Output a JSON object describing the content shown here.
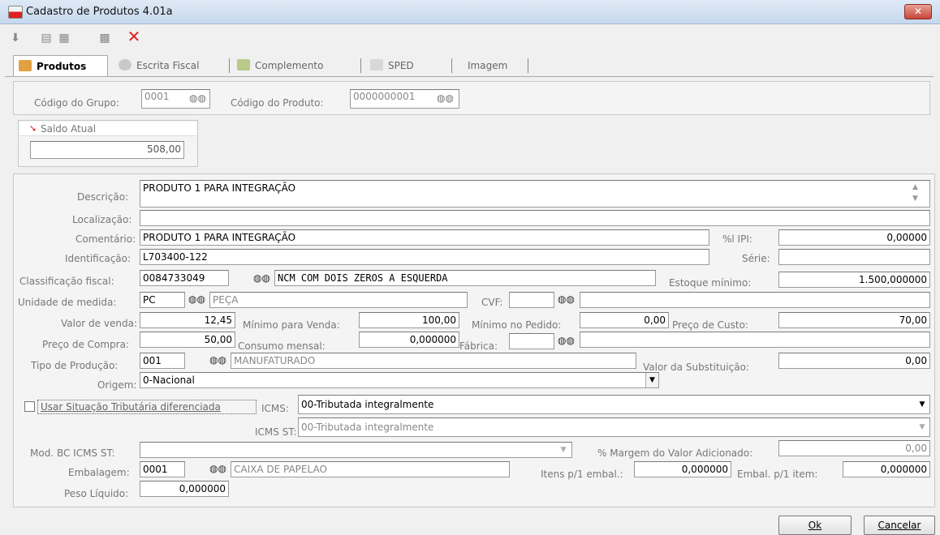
{
  "window": {
    "title": "Cadastro de Produtos 4.01a",
    "close": "✕"
  },
  "toolbar": {
    "delete_label": "✕"
  },
  "tabs": [
    "Produtos",
    "Escrita Fiscal",
    "Complemento",
    "SPED",
    "Imagem"
  ],
  "header": {
    "grupo_label": "Código do Grupo:",
    "grupo_value": "0001",
    "produto_label": "Código do Produto:",
    "produto_value": "0000000001"
  },
  "saldo": {
    "label": "Saldo Atual",
    "value": "508,00"
  },
  "form": {
    "descricao_label": "Descrição:",
    "descricao": "PRODUTO 1 PARA INTEGRAÇÃO",
    "localizacao_label": "Localização:",
    "localizacao": "",
    "comentario_label": "Comentário:",
    "comentario": "PRODUTO 1 PARA INTEGRAÇÃO",
    "ipi_label": "%l IPI:",
    "ipi": "0,00000",
    "identificacao_label": "Identificação:",
    "identificacao": "L703400-122",
    "serie_label": "Série:",
    "serie": "",
    "classificacao_label": "Classificação fiscal:",
    "classificacao": "0084733049",
    "ncm_desc": "NCM COM DOIS ZEROS A ESQUERDA",
    "estoque_min_label": "Estoque mínimo:",
    "estoque_min": "1.500,000000",
    "unidade_label": "Unidade de medida:",
    "unidade": "PC",
    "unidade_desc": "PEÇA",
    "cvf_label": "CVF:",
    "cvf": "",
    "cvf_desc": "",
    "valor_venda_label": "Valor de venda:",
    "valor_venda": "12,45",
    "min_venda_label": "Mínimo para Venda:",
    "min_venda": "100,00",
    "min_pedido_label": "Mínimo no Pedido:",
    "min_pedido": "0,00",
    "preco_custo_label": "Preço de Custo:",
    "preco_custo": "70,00",
    "preco_compra_label": "Preço de Compra:",
    "preco_compra": "50,00",
    "consumo_label": "Consumo mensal:",
    "consumo": "0,000000",
    "fabrica_label": "Fábrica:",
    "fabrica": "",
    "fabrica_desc": "",
    "tipo_prod_label": "Tipo de Produção:",
    "tipo_prod": "001",
    "tipo_prod_desc": "MANUFATURADO",
    "valor_subst_label": "Valor da Substituição:",
    "valor_subst": "0,00",
    "origem_label": "Origem:",
    "origem": "0-Nacional",
    "usar_sit_label": "Usar Situação Tributária diferenciada",
    "icms_label": "ICMS:",
    "icms": "00-Tributada integralmente",
    "icms_st_label": "ICMS ST:",
    "icms_st": "00-Tributada integralmente",
    "mod_bc_label": "Mod. BC ICMS ST:",
    "mod_bc": "",
    "margem_label": "% Margem do Valor Adicionado:",
    "margem": "0,00",
    "embalagem_label": "Embalagem:",
    "embalagem": "0001",
    "embalagem_desc": "CAIXA DE PAPELAO",
    "itens_embal_label": "Itens p/1 embal.:",
    "itens_embal": "0,000000",
    "embal_item_label": "Embal. p/1 item:",
    "embal_item": "0,000000",
    "peso_label": "Peso Líquido:",
    "peso": "0,000000"
  },
  "buttons": {
    "ok": "Ok",
    "cancelar": "Cancelar"
  }
}
